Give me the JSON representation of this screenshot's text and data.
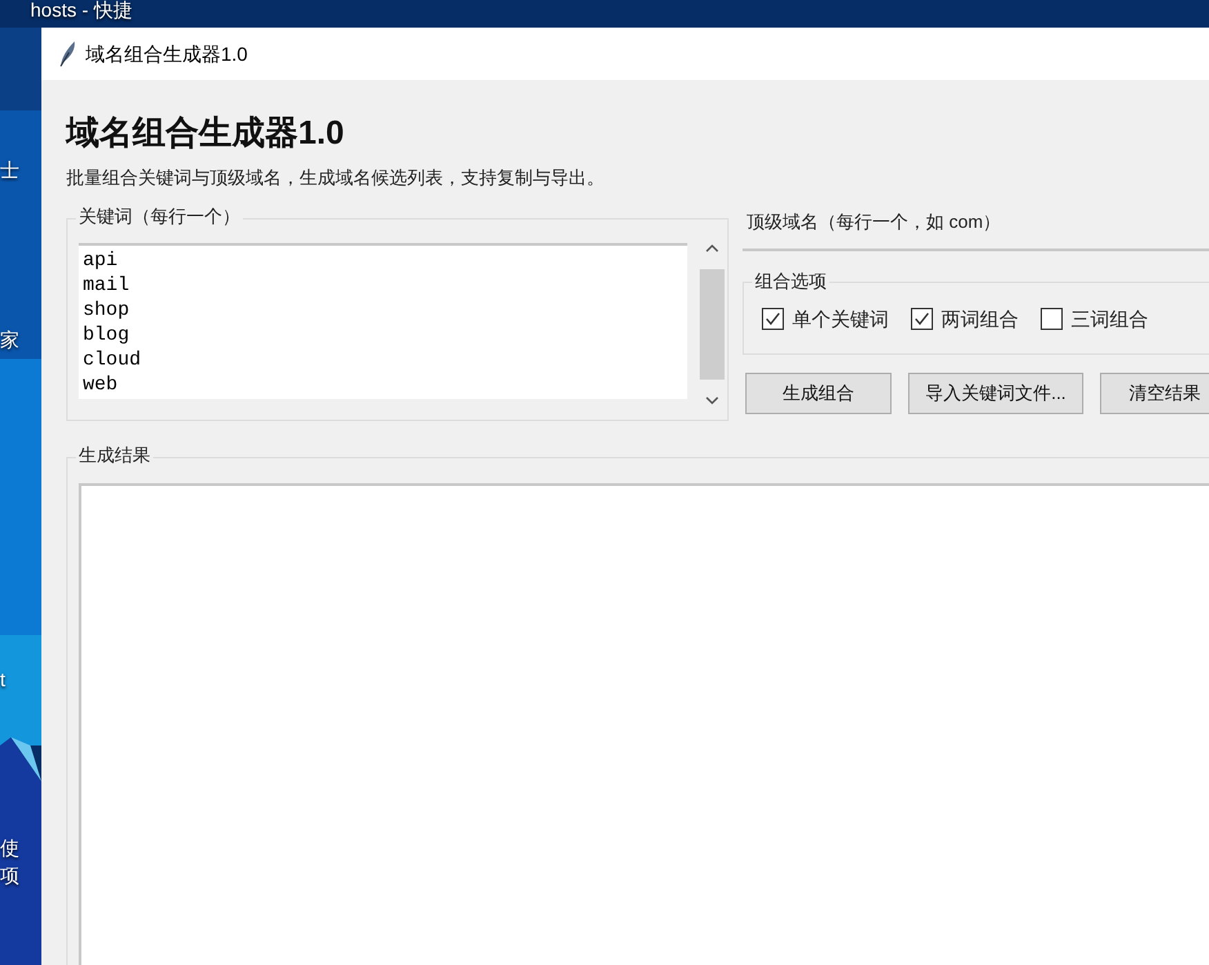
{
  "desktop": {
    "labels": [
      {
        "text": "hosts - 快捷"
      },
      {
        "text": "士"
      },
      {
        "text": "家"
      },
      {
        "text": "t"
      },
      {
        "text": "使"
      },
      {
        "text": "项"
      }
    ]
  },
  "window": {
    "title": "域名组合生成器1.0"
  },
  "heading": "域名组合生成器1.0",
  "subtitle": "批量组合关键词与顶级域名，生成域名候选列表，支持复制与导出。",
  "keywords": {
    "label": "关键词（每行一个）",
    "lines": [
      "api",
      "mail",
      "shop",
      "blog",
      "cloud",
      "web"
    ]
  },
  "tlds": {
    "label": "顶级域名（每行一个，如 com）"
  },
  "options": {
    "label": "组合选项",
    "items": [
      {
        "label": "单个关键词",
        "checked": true
      },
      {
        "label": "两词组合",
        "checked": true
      },
      {
        "label": "三词组合",
        "checked": false
      }
    ]
  },
  "buttons": [
    "生成组合",
    "导入关键词文件...",
    "清空结果"
  ],
  "results": {
    "label": "生成结果"
  }
}
